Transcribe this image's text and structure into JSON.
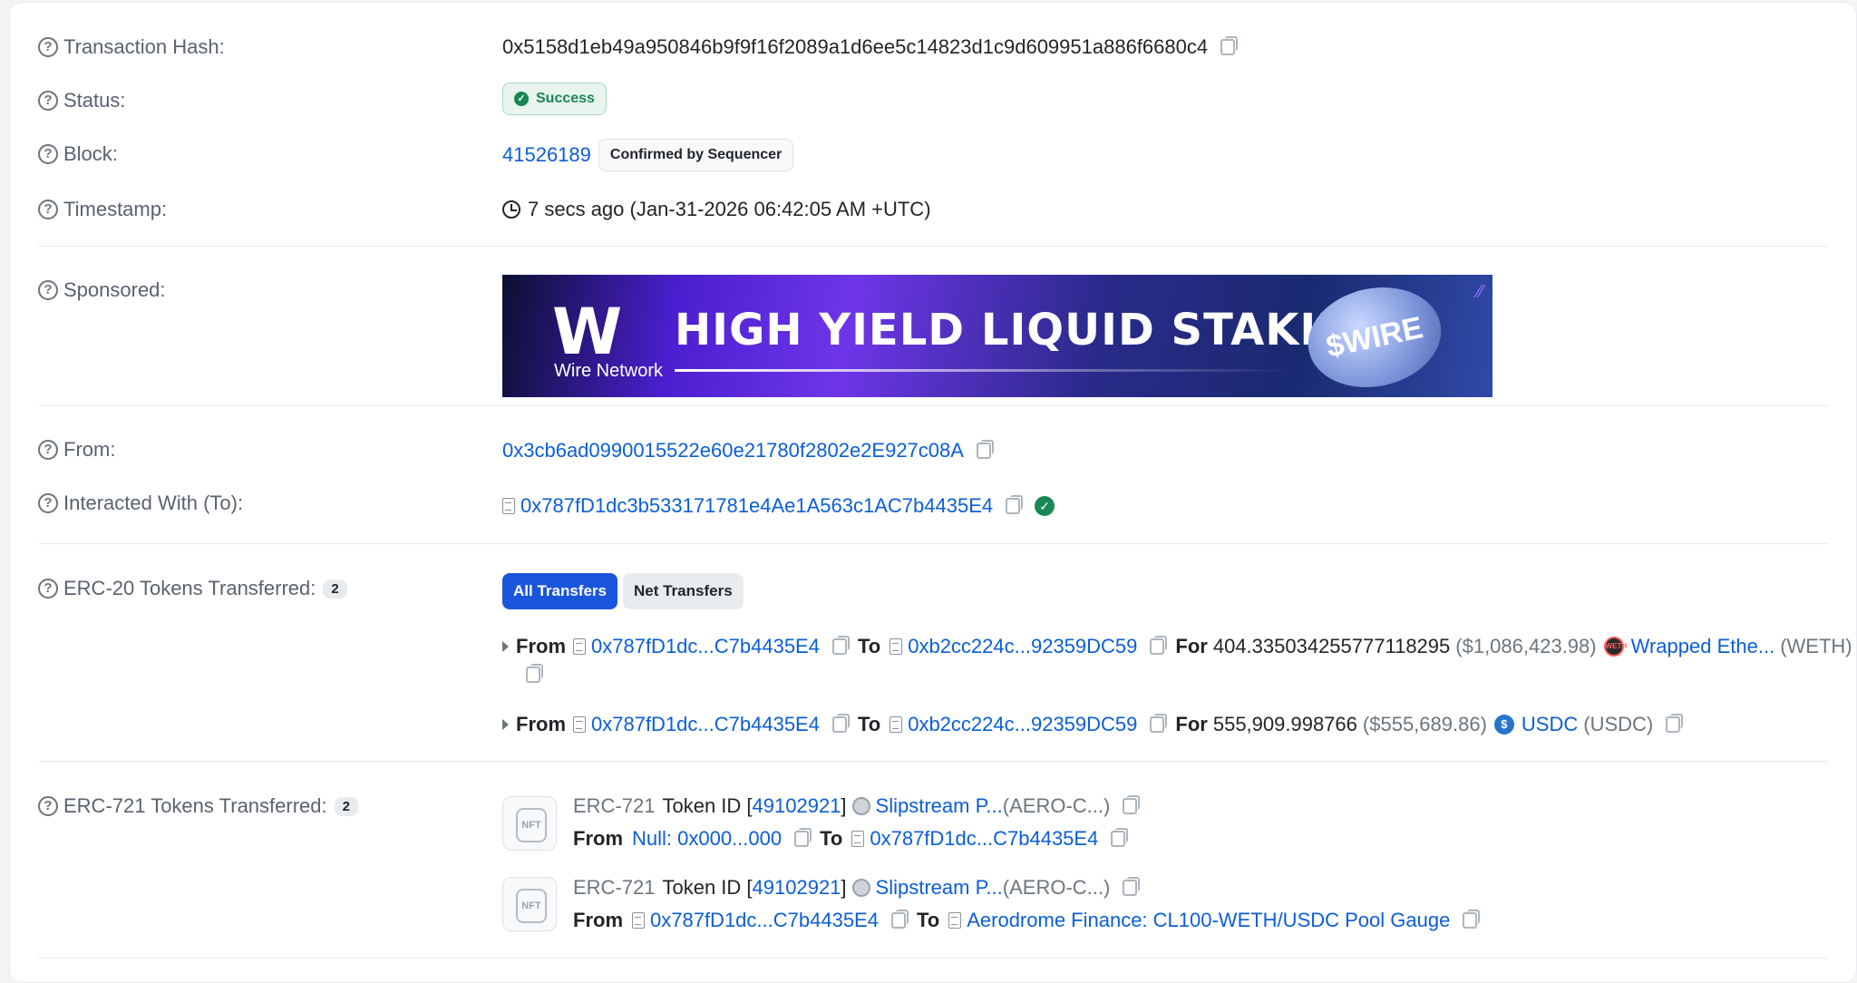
{
  "tx": {
    "hash_label": "Transaction Hash:",
    "hash": "0x5158d1eb49a950846b9f9f16f2089a1d6ee5c14823d1c9d609951a886f6680c4",
    "status_label": "Status:",
    "status": "Success",
    "block_label": "Block:",
    "block": "41526189",
    "block_tag": "Confirmed by Sequencer",
    "timestamp_label": "Timestamp:",
    "timestamp": "7 secs ago (Jan-31-2026 06:42:05 AM +UTC)",
    "sponsored_label": "Sponsored:",
    "from_label": "From:",
    "from": "0x3cb6ad0990015522e60e21780f2802e2E927c08A",
    "to_label": "Interacted With (To):",
    "to": "0x787fD1dc3b533171781e4Ae1A563c1AC7b4435E4"
  },
  "banner": {
    "logo": "W",
    "brand": "Wire Network",
    "title": "HIGH YIELD LIQUID STAKING",
    "coin": "$WIRE"
  },
  "erc20": {
    "label": "ERC-20 Tokens Transferred:",
    "count": "2",
    "tab_all": "All Transfers",
    "tab_net": "Net Transfers",
    "transfers": [
      {
        "from_word": "From",
        "from": "0x787fD1dc...C7b4435E4",
        "to_word": "To",
        "to": "0xb2cc224c...92359DC59",
        "for_word": "For",
        "amount": "404.335034255777118295",
        "usd": "($1,086,423.98)",
        "token": "Wrapped Ethe...",
        "symbol": "(WETH)",
        "logo": "WETH"
      },
      {
        "from_word": "From",
        "from": "0x787fD1dc...C7b4435E4",
        "to_word": "To",
        "to": "0xb2cc224c...92359DC59",
        "for_word": "For",
        "amount": "555,909.998766",
        "usd": "($555,689.86)",
        "token": "USDC",
        "symbol": "(USDC)",
        "logo": "$"
      }
    ]
  },
  "erc721": {
    "label": "ERC-721 Tokens Transferred:",
    "count": "2",
    "items": [
      {
        "std": "ERC-721",
        "token_id_word": "Token ID [",
        "token_id": "49102921",
        "bracket": "]",
        "collection": "Slipstream P...",
        "collection_sym": "(AERO-C...)",
        "from_word": "From",
        "from": "Null: 0x000...000",
        "to_word": "To",
        "to": "0x787fD1dc...C7b4435E4",
        "nft": "NFT"
      },
      {
        "std": "ERC-721",
        "token_id_word": "Token ID [",
        "token_id": "49102921",
        "bracket": "]",
        "collection": "Slipstream P...",
        "collection_sym": "(AERO-C...)",
        "from_word": "From",
        "from": "0x787fD1dc...C7b4435E4",
        "to_word": "To",
        "to": "Aerodrome Finance: CL100-WETH/USDC Pool Gauge",
        "nft": "NFT"
      }
    ]
  },
  "icons": {
    "help": "?",
    "tick": "✓"
  }
}
